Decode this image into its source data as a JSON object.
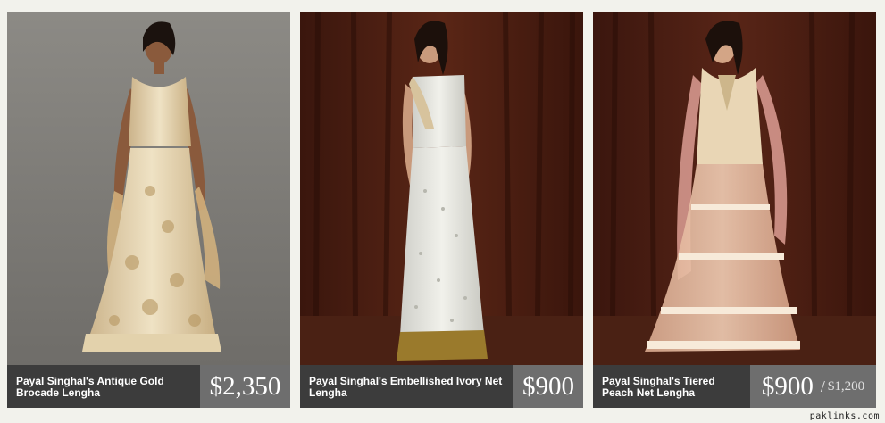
{
  "products": [
    {
      "name": "Payal Singhal's Antique Gold Brocade Lengha",
      "price": "$2,350",
      "photo_alt": "Model wearing antique gold brocade lengha"
    },
    {
      "name": "Payal Singhal's Embellished Ivory Net Lengha",
      "price": "$900",
      "photo_alt": "Model wearing embellished ivory net lengha"
    },
    {
      "name": "Payal Singhal's Tiered Peach Net Lengha",
      "price": "$900",
      "price_separator": "/",
      "original_price": "$1,200",
      "photo_alt": "Model wearing tiered peach net lengha"
    }
  ],
  "watermark": "paklinks.com",
  "colors": {
    "caption_bg": "#3c3c3c",
    "price_bg": "#6e6e6e",
    "page_bg": "#f2f2ec"
  }
}
